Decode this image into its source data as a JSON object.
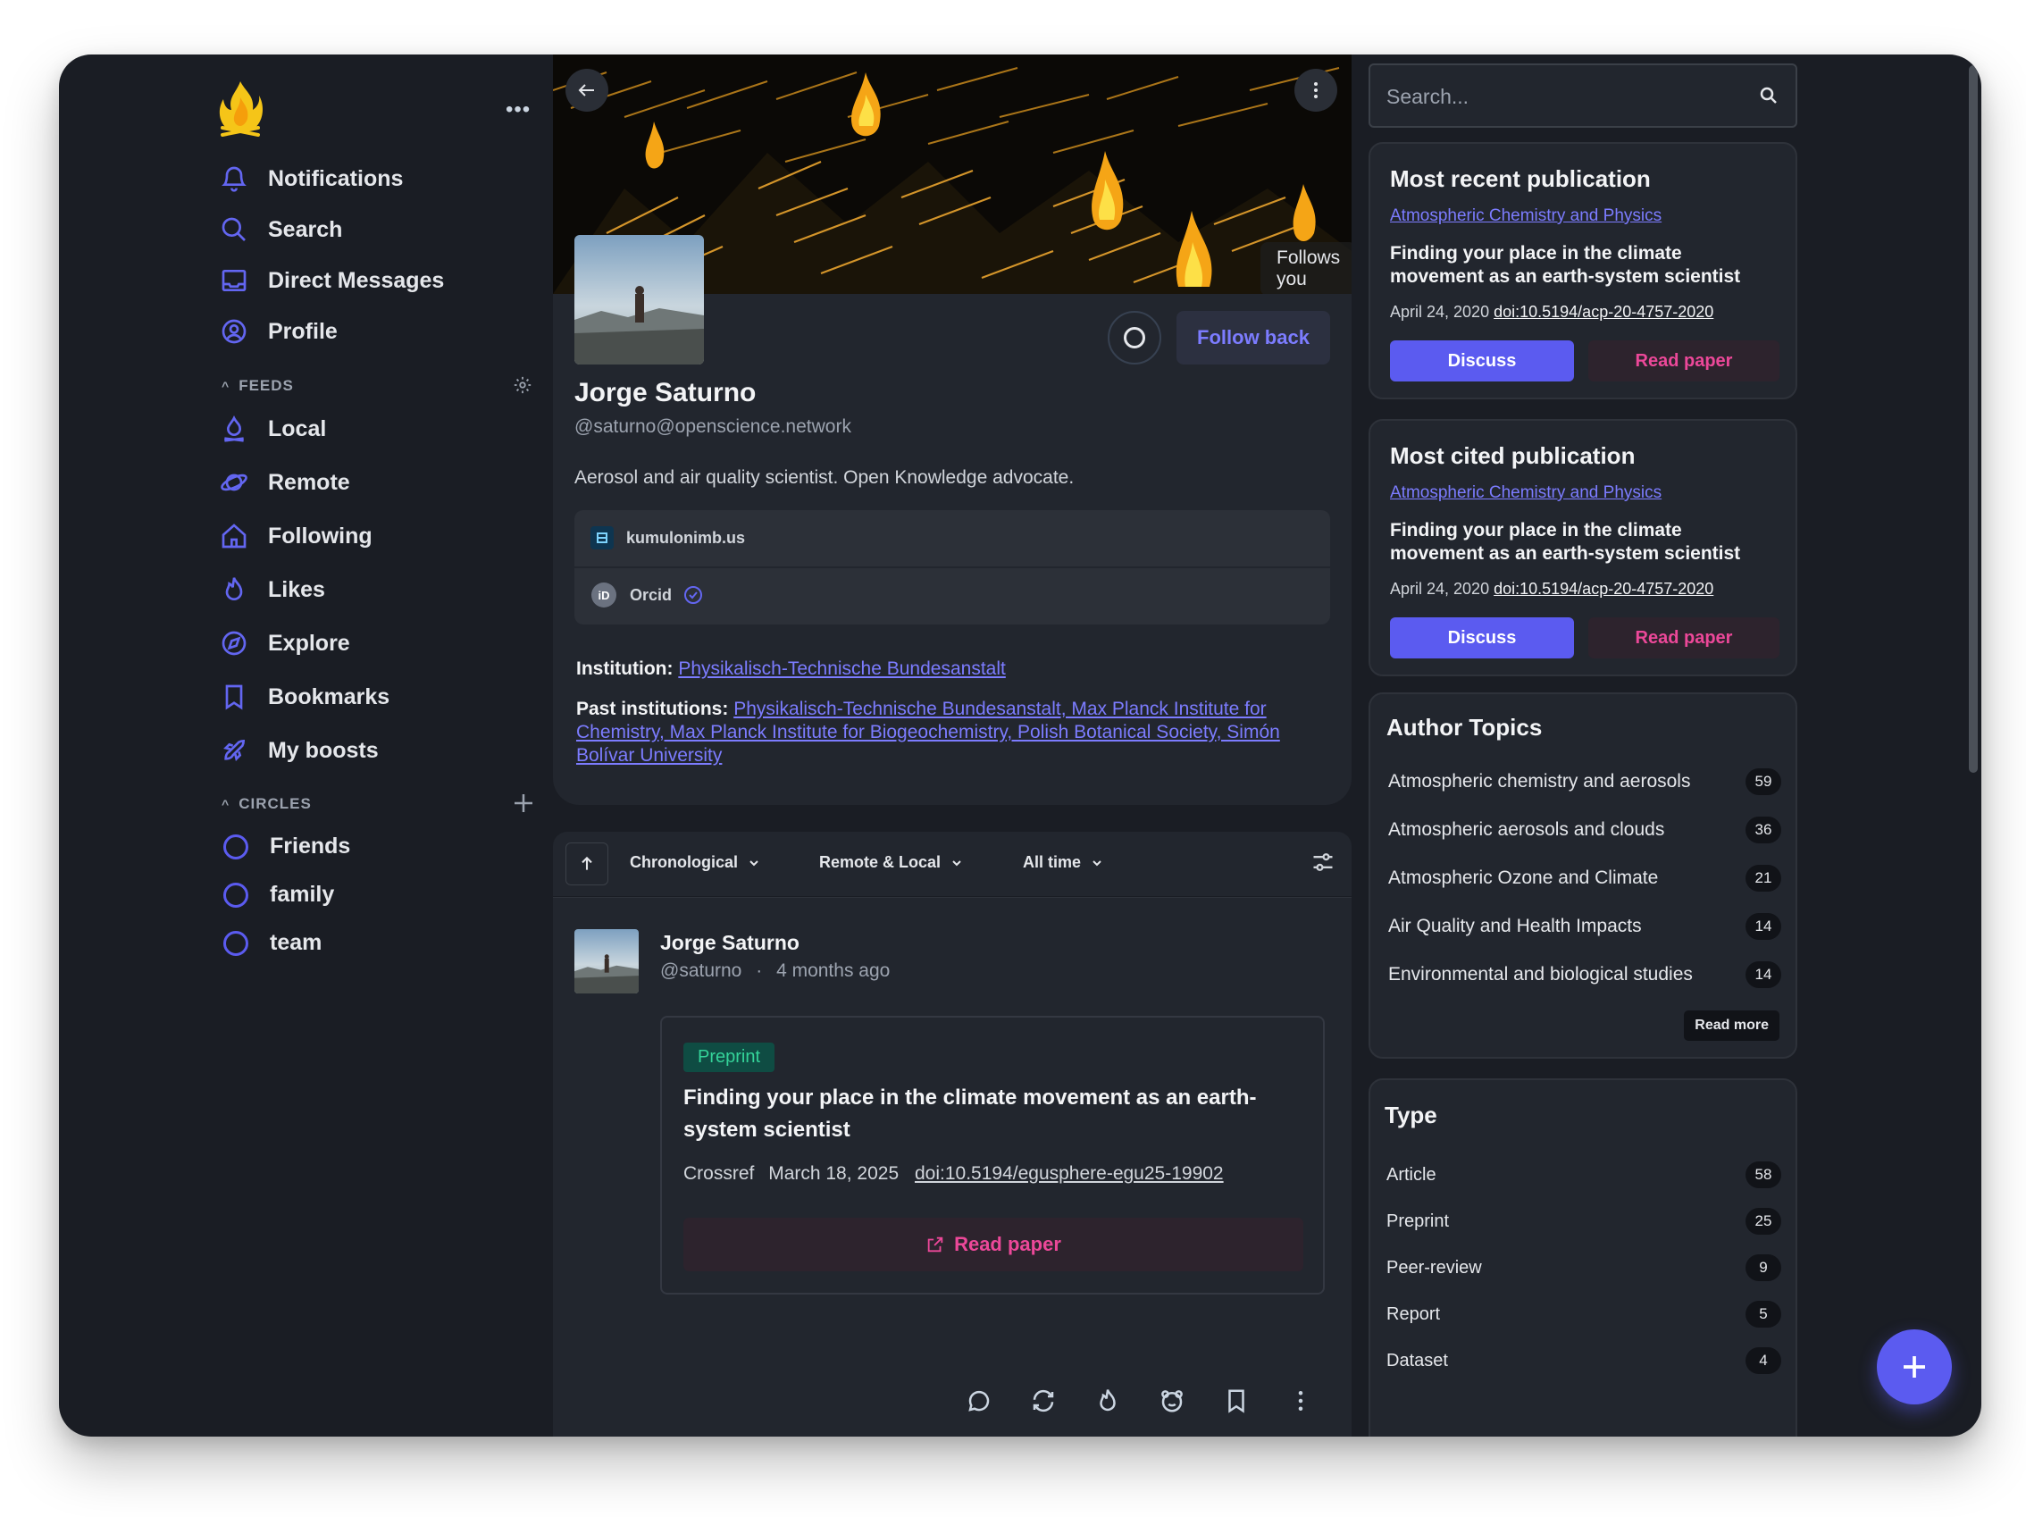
{
  "sidebar": {
    "nav": [
      {
        "label": "Notifications",
        "icon": "bell-icon"
      },
      {
        "label": "Search",
        "icon": "search-icon"
      },
      {
        "label": "Direct Messages",
        "icon": "inbox-icon"
      },
      {
        "label": "Profile",
        "icon": "user-circle-icon"
      }
    ],
    "feeds_heading": "FEEDS",
    "feeds": [
      {
        "label": "Local",
        "icon": "campfire-icon"
      },
      {
        "label": "Remote",
        "icon": "planet-icon"
      },
      {
        "label": "Following",
        "icon": "home-icon"
      },
      {
        "label": "Likes",
        "icon": "flame-icon"
      },
      {
        "label": "Explore",
        "icon": "compass-icon"
      },
      {
        "label": "Bookmarks",
        "icon": "bookmark-icon"
      },
      {
        "label": "My boosts",
        "icon": "rocket-icon"
      }
    ],
    "circles_heading": "CIRCLES",
    "circles": [
      {
        "label": "Friends"
      },
      {
        "label": "family"
      },
      {
        "label": "team"
      }
    ]
  },
  "profile": {
    "follows_you": "Follows you",
    "follow_back": "Follow back",
    "name": "Jorge Saturno",
    "handle": "@saturno@openscience.network",
    "bio": "Aerosol and air quality scientist. Open Knowledge advocate.",
    "website": "kumulonimb.us",
    "orcid": "Orcid",
    "institution_label": "Institution:",
    "institution": "Physikalisch-Technische Bundesanstalt",
    "past_label": "Past institutions:",
    "past_institutions": "Physikalisch-Technische Bundesanstalt, Max Planck Institute for Chemistry, Max Planck Institute for Biogeochemistry, Polish Botanical Society, Simón Bolívar University"
  },
  "feed_controls": {
    "sort": "Chronological",
    "source": "Remote & Local",
    "time": "All time"
  },
  "post": {
    "author": "Jorge Saturno",
    "handle": "@saturno",
    "separator": "·",
    "time_ago": "4 months ago",
    "badge": "Preprint",
    "title": "Finding your place in the climate movement as an earth-system scientist",
    "source": "Crossref",
    "date": "March 18, 2025",
    "doi": "doi:10.5194/egusphere-egu25-19902",
    "read_paper": "Read paper"
  },
  "right": {
    "search_placeholder": "Search...",
    "recent": {
      "title": "Most recent publication",
      "journal": "Atmospheric Chemistry and Physics",
      "paper": "Finding your place in the climate movement as an earth-system scientist",
      "date": "April 24, 2020",
      "doi": "doi:10.5194/acp-20-4757-2020",
      "discuss": "Discuss",
      "read": "Read paper"
    },
    "cited": {
      "title": "Most cited publication",
      "journal": "Atmospheric Chemistry and Physics",
      "paper": "Finding your place in the climate movement as an earth-system scientist",
      "date": "April 24, 2020",
      "doi": "doi:10.5194/acp-20-4757-2020",
      "discuss": "Discuss",
      "read": "Read paper"
    },
    "topics": {
      "title": "Author Topics",
      "items": [
        {
          "label": "Atmospheric chemistry and aerosols",
          "count": "59"
        },
        {
          "label": "Atmospheric aerosols and clouds",
          "count": "36"
        },
        {
          "label": "Atmospheric Ozone and Climate",
          "count": "21"
        },
        {
          "label": "Air Quality and Health Impacts",
          "count": "14"
        },
        {
          "label": "Environmental and biological studies",
          "count": "14"
        }
      ],
      "read_more": "Read more"
    },
    "types": {
      "title": "Type",
      "items": [
        {
          "label": "Article",
          "count": "58"
        },
        {
          "label": "Preprint",
          "count": "25"
        },
        {
          "label": "Peer-review",
          "count": "9"
        },
        {
          "label": "Report",
          "count": "5"
        },
        {
          "label": "Dataset",
          "count": "4"
        }
      ]
    }
  },
  "colors": {
    "accent": "#5b5bf0",
    "link": "#7c7cff",
    "pink": "#ec4899",
    "background": "#1a1d24",
    "card": "#22262e"
  }
}
